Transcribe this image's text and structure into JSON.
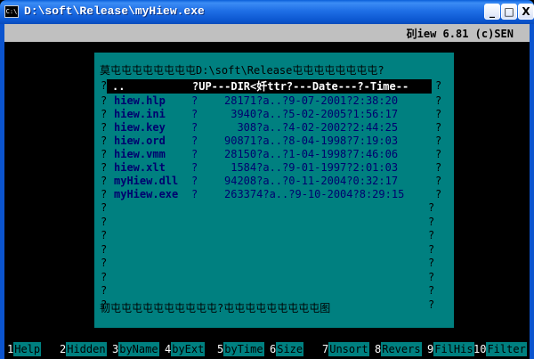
{
  "window": {
    "title": "D:\\soft\\Release\\myHiew.exe",
    "icon": "console-icon",
    "controls": {
      "minimize": "_",
      "maximize": "□",
      "close": "X"
    }
  },
  "status": {
    "text": "矵iew 6.81 (c)SEN"
  },
  "panel": {
    "top_border": "莫屯屯屯屯屯屯屯屯D:\\soft\\Release屯屯屯屯屯屯屯屯?",
    "header_left": "..",
    "header_right": "?UP---DIR<奷ttr?---Date---?-Time--",
    "bottom_border": "韧屯屯屯屯屯屯屯屯屯屯?屯屯屯屯屯屯屯屯屯图",
    "side_char": "?",
    "files": [
      {
        "name": "hiew.hlp",
        "q": "?",
        "info": "28171?a..?9-07-2001?2:38:20"
      },
      {
        "name": "hiew.ini",
        "q": "?",
        "info": " 3940?a..?5-02-2005?1:56:17"
      },
      {
        "name": "hiew.key",
        "q": "?",
        "info": "  308?a..?4-02-2002?2:44:25"
      },
      {
        "name": "hiew.ord",
        "q": "?",
        "info": "90871?a..?8-04-1998?7:19:03"
      },
      {
        "name": "hiew.vmm",
        "q": "?",
        "info": "28150?a..?1-04-1998?7:46:06"
      },
      {
        "name": "hiew.xlt",
        "q": "?",
        "info": " 1584?a..?9-01-1997?2:01:03"
      },
      {
        "name": "myHiew.dll",
        "q": "?",
        "info": "94208?a..?0-11-2004?0:32:17"
      },
      {
        "name": "myHiew.exe",
        "q": "?",
        "info": "263374?a..?9-10-2004?8:29:15"
      }
    ]
  },
  "fkeys": [
    {
      "num": "1",
      "label": "Help"
    },
    {
      "num": "2",
      "label": "Hidden"
    },
    {
      "num": "3",
      "label": "byName"
    },
    {
      "num": "4",
      "label": "byExt"
    },
    {
      "num": "5",
      "label": "byTime"
    },
    {
      "num": "6",
      "label": "Size"
    },
    {
      "num": "7",
      "label": "Unsort"
    },
    {
      "num": "8",
      "label": "Revers"
    },
    {
      "num": "9",
      "label": "FilHis"
    },
    {
      "num": "10",
      "label": "Filter"
    }
  ]
}
